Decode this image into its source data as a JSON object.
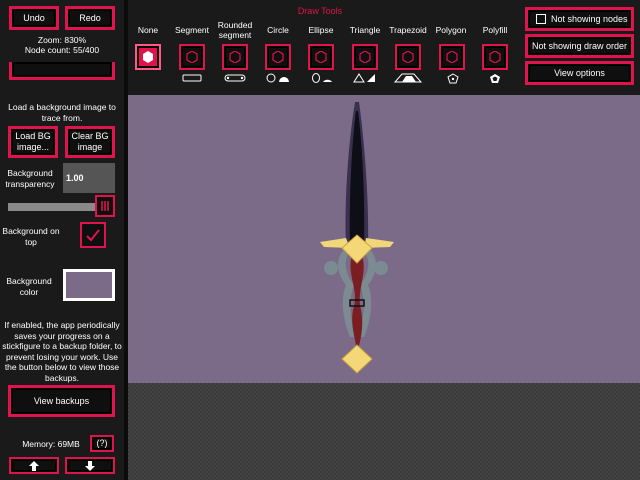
{
  "sidebar": {
    "undo_label": "Undo",
    "redo_label": "Redo",
    "zoom_text": "Zoom: 830%",
    "node_count_text": "Node count: 55/400",
    "bg_hint_text": "Load a background image to trace from.",
    "load_bg_label": "Load BG image...",
    "clear_bg_label": "Clear BG image",
    "bg_transparency_label": "Background transparency",
    "bg_transparency_value": "1.00",
    "bg_transparency_slider": 1.0,
    "bg_on_top_label": "Background on top",
    "bg_on_top_checked": true,
    "bg_color_label": "Background color",
    "bg_color_value": "#7b6b88",
    "backup_text": "If enabled, the app periodically saves your progress on a stickfigure to a backup folder, to prevent losing your work. Use the button below to view those backups.",
    "view_backups_label": "View backups",
    "memory_text": "Memory: 69MB",
    "help_label": "(?)",
    "up_icon": "arrow-up-icon",
    "down_icon": "arrow-down-icon"
  },
  "toolbar": {
    "title": "Draw Tools",
    "tools": [
      {
        "label": "None",
        "selected": true
      },
      {
        "label": "Segment",
        "selected": false
      },
      {
        "label": "Rounded segment",
        "selected": false
      },
      {
        "label": "Circle",
        "selected": false
      },
      {
        "label": "Ellipse",
        "selected": false
      },
      {
        "label": "Triangle",
        "selected": false
      },
      {
        "label": "Trapezoid",
        "selected": false
      },
      {
        "label": "Polygon",
        "selected": false
      },
      {
        "label": "Polyfill",
        "selected": false
      }
    ],
    "not_showing_nodes_label": "Not showing nodes",
    "not_showing_draw_order_label": "Not showing draw order",
    "view_options_label": "View options"
  },
  "colors": {
    "accent": "#e0134f",
    "panel": "#1a1a1a",
    "canvas": "#7b6b88"
  }
}
